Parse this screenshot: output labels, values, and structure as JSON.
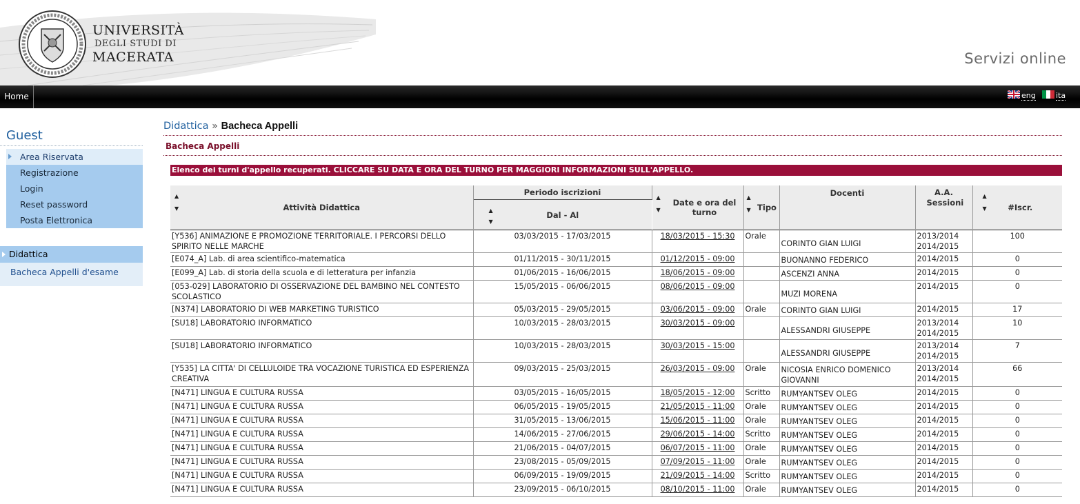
{
  "header": {
    "univ_line1": "UNIVERSITÀ",
    "univ_line2": "DEGLI STUDI DI",
    "univ_line3": "MACERATA",
    "servizi": "Servizi online"
  },
  "nav": {
    "home": "Home",
    "lang_en": "eng",
    "lang_it": "ita"
  },
  "sidebar": {
    "guest_title": "Guest",
    "items": [
      "Area Riservata",
      "Registrazione",
      "Login",
      "Reset password",
      "Posta Elettronica"
    ],
    "didattica_title": "Didattica",
    "didattica_link": "Bacheca Appelli d'esame"
  },
  "breadcrumb": {
    "parent": "Didattica",
    "sep": "»",
    "current": "Bacheca Appelli"
  },
  "subtitle": "Bacheca Appelli",
  "banner": "Elenco dei turni d'appello recuperati. CLICCARE SU DATA E ORA DEL TURNO PER MAGGIORI INFORMAZIONI SULL'APPELLO.",
  "table": {
    "headers": {
      "attivita": "Attività Didattica",
      "periodo": "Periodo iscrizioni",
      "dal_al": "Dal - Al",
      "date_ora": "Date e ora del turno",
      "tipo": "Tipo",
      "docenti": "Docenti",
      "aa": "A.A. Sessioni",
      "iscr": "#Iscr."
    },
    "rows": [
      {
        "att": "[Y536] ANIMAZIONE E PROMOZIONE TERRITORIALE. I PERCORSI DELLO SPIRITO NELLE MARCHE",
        "per": "03/03/2015 - 17/03/2015",
        "date": "18/03/2015 - 15:30",
        "tipo": "Orale",
        "doc": "CORINTO GIAN LUIGI",
        "aa": "2013/2014 2014/2015",
        "iscr": "100"
      },
      {
        "att": "[E074_A] Lab. di area scientifico-matematica",
        "per": "01/11/2015 - 30/11/2015",
        "date": "01/12/2015 - 09:00",
        "tipo": "",
        "doc": "BUONANNO FEDERICO",
        "aa": "2014/2015",
        "iscr": "0"
      },
      {
        "att": "[E099_A] Lab. di storia della scuola e di letteratura per infanzia",
        "per": "01/06/2015 - 16/06/2015",
        "date": "18/06/2015 - 09:00",
        "tipo": "",
        "doc": "ASCENZI ANNA",
        "aa": "2014/2015",
        "iscr": "0"
      },
      {
        "att": "[053-029] LABORATORIO DI OSSERVAZIONE DEL BAMBINO NEL CONTESTO SCOLASTICO",
        "per": "15/05/2015 - 06/06/2015",
        "date": "08/06/2015 - 09:00",
        "tipo": "",
        "doc": "MUZI MORENA",
        "aa": "2014/2015",
        "iscr": "0"
      },
      {
        "att": "[N374] LABORATORIO DI WEB MARKETING TURISTICO",
        "per": "05/03/2015 - 29/05/2015",
        "date": "03/06/2015 - 09:00",
        "tipo": "Orale",
        "doc": "CORINTO GIAN LUIGI",
        "aa": "2014/2015",
        "iscr": "17"
      },
      {
        "att": "[SU18] LABORATORIO INFORMATICO",
        "per": "10/03/2015 - 28/03/2015",
        "date": "30/03/2015 - 09:00",
        "tipo": "",
        "doc": "ALESSANDRI GIUSEPPE",
        "aa": "2013/2014 2014/2015",
        "iscr": "10"
      },
      {
        "att": "[SU18] LABORATORIO INFORMATICO",
        "per": "10/03/2015 - 28/03/2015",
        "date": "30/03/2015 - 15:00",
        "tipo": "",
        "doc": "ALESSANDRI GIUSEPPE",
        "aa": "2013/2014 2014/2015",
        "iscr": "7"
      },
      {
        "att": "[Y535] LA CITTA' DI CELLULOIDE TRA VOCAZIONE TURISTICA ED ESPERIENZA CREATIVA",
        "per": "09/03/2015 - 25/03/2015",
        "date": "26/03/2015 - 09:00",
        "tipo": "Orale",
        "doc": "NICOSIA ENRICO DOMENICO GIOVANNI",
        "aa": "2013/2014 2014/2015",
        "iscr": "66"
      },
      {
        "att": "[N471] LINGUA E CULTURA RUSSA",
        "per": "03/05/2015 - 16/05/2015",
        "date": "18/05/2015 - 12:00",
        "tipo": "Scritto",
        "doc": "RUMYANTSEV OLEG",
        "aa": "2014/2015",
        "iscr": "0"
      },
      {
        "att": "[N471] LINGUA E CULTURA RUSSA",
        "per": "06/05/2015 - 19/05/2015",
        "date": "21/05/2015 - 11:00",
        "tipo": "Orale",
        "doc": "RUMYANTSEV OLEG",
        "aa": "2014/2015",
        "iscr": "0"
      },
      {
        "att": "[N471] LINGUA E CULTURA RUSSA",
        "per": "31/05/2015 - 13/06/2015",
        "date": "15/06/2015 - 11:00",
        "tipo": "Orale",
        "doc": "RUMYANTSEV OLEG",
        "aa": "2014/2015",
        "iscr": "0"
      },
      {
        "att": "[N471] LINGUA E CULTURA RUSSA",
        "per": "14/06/2015 - 27/06/2015",
        "date": "29/06/2015 - 14:00",
        "tipo": "Scritto",
        "doc": "RUMYANTSEV OLEG",
        "aa": "2014/2015",
        "iscr": "0"
      },
      {
        "att": "[N471] LINGUA E CULTURA RUSSA",
        "per": "21/06/2015 - 04/07/2015",
        "date": "06/07/2015 - 11:00",
        "tipo": "Orale",
        "doc": "RUMYANTSEV OLEG",
        "aa": "2014/2015",
        "iscr": "0"
      },
      {
        "att": "[N471] LINGUA E CULTURA RUSSA",
        "per": "23/08/2015 - 05/09/2015",
        "date": "07/09/2015 - 11:00",
        "tipo": "Orale",
        "doc": "RUMYANTSEV OLEG",
        "aa": "2014/2015",
        "iscr": "0"
      },
      {
        "att": "[N471] LINGUA E CULTURA RUSSA",
        "per": "06/09/2015 - 19/09/2015",
        "date": "21/09/2015 - 14:00",
        "tipo": "Scritto",
        "doc": "RUMYANTSEV OLEG",
        "aa": "2014/2015",
        "iscr": "0"
      },
      {
        "att": "[N471] LINGUA E CULTURA RUSSA",
        "per": "23/09/2015 - 06/10/2015",
        "date": "08/10/2015 - 11:00",
        "tipo": "Orale",
        "doc": "RUMYANTSEV OLEG",
        "aa": "2014/2015",
        "iscr": "0"
      }
    ]
  }
}
